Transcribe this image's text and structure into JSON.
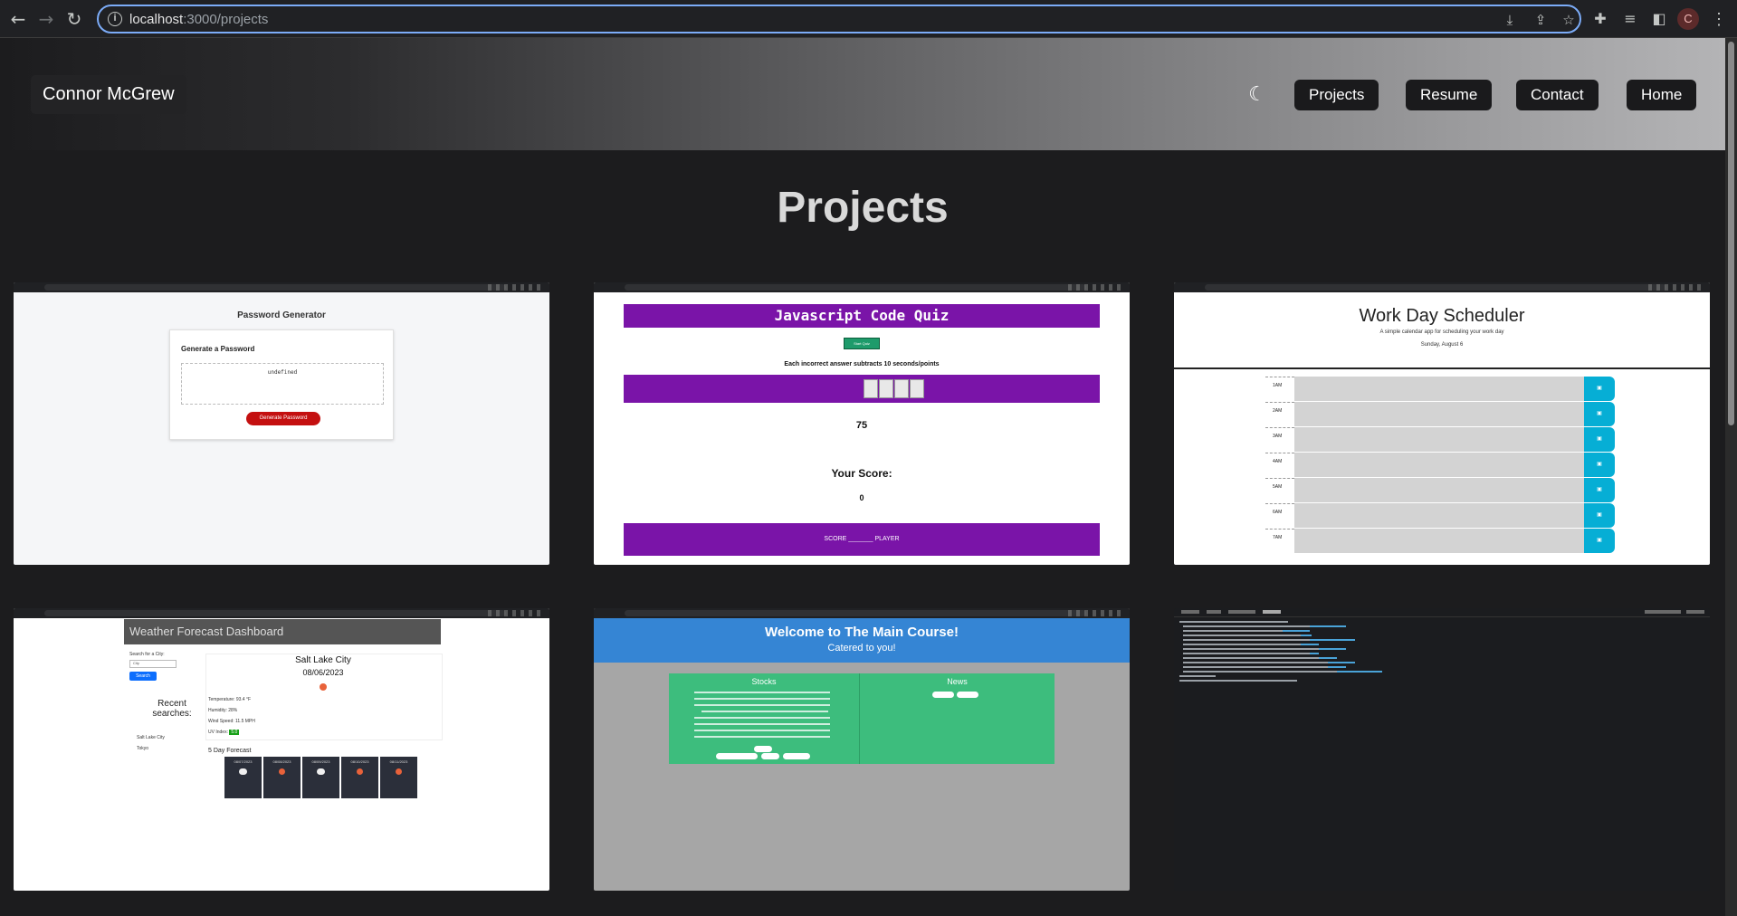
{
  "browser": {
    "url_host": "localhost",
    "url_path": ":3000/projects",
    "profile_initial": "C"
  },
  "site": {
    "brand": "Connor McGrew",
    "nav": [
      {
        "label": "Projects"
      },
      {
        "label": "Resume"
      },
      {
        "label": "Contact"
      },
      {
        "label": "Home"
      }
    ]
  },
  "page": {
    "title": "Projects"
  },
  "projects": [
    {
      "screenshot": "Password Generator",
      "heading": "Password Generator",
      "subheading": "Generate a Password",
      "output": "undefined",
      "button": "Generate Password"
    },
    {
      "screenshot": "Javascript Code Quiz",
      "heading": "Javascript Code Quiz",
      "start": "Start Quiz",
      "warning": "Each incorrect answer subtracts 10 seconds/points",
      "timer": "75",
      "score_label": "Your Score:",
      "score_value": "0",
      "footer": "SCORE _______ PLAYER"
    },
    {
      "screenshot": "Work Day Scheduler",
      "heading": "Work Day Scheduler",
      "tagline": "A simple calendar app for scheduling your work day",
      "date": "Sunday, August 6",
      "hours": [
        "1AM",
        "2AM",
        "3AM",
        "4AM",
        "5AM",
        "6AM",
        "7AM"
      ]
    },
    {
      "screenshot": "Weather Forecast Dashboard",
      "heading": "Weather Forecast Dashboard",
      "search_label": "Search for a City:",
      "search_placeholder": "City",
      "search_button": "Search",
      "recent_title": "Recent searches:",
      "recent": [
        "Salt Lake City",
        "Tokyo"
      ],
      "city": "Salt Lake City",
      "date": "08/06/2023",
      "temperature": "Temperature: 93.4 °F",
      "humidity": "Humidity: 28%",
      "wind": "Wind Speed: 11.5 MPH",
      "uv_label": "UV Index:",
      "uv_value": "5.0",
      "forecast_title": "5 Day Forecast",
      "forecast_dates": [
        "08/07/2023",
        "08/08/2023",
        "08/09/2023",
        "08/10/2023",
        "08/11/2023"
      ]
    },
    {
      "screenshot": "Welcome to The Main Course!",
      "heading": "Welcome to The Main Course!",
      "subheading": "Catered to you!",
      "stocks_title": "Stocks",
      "news_title": "News"
    },
    {
      "screenshot": "README generator terminal"
    }
  ],
  "colors": {
    "quiz_purple": "#7a14a8",
    "scheduler_blue": "#06aed5",
    "main_course_blue": "#3585d4",
    "main_course_green": "#3dbd7d",
    "password_red": "#c41010"
  }
}
